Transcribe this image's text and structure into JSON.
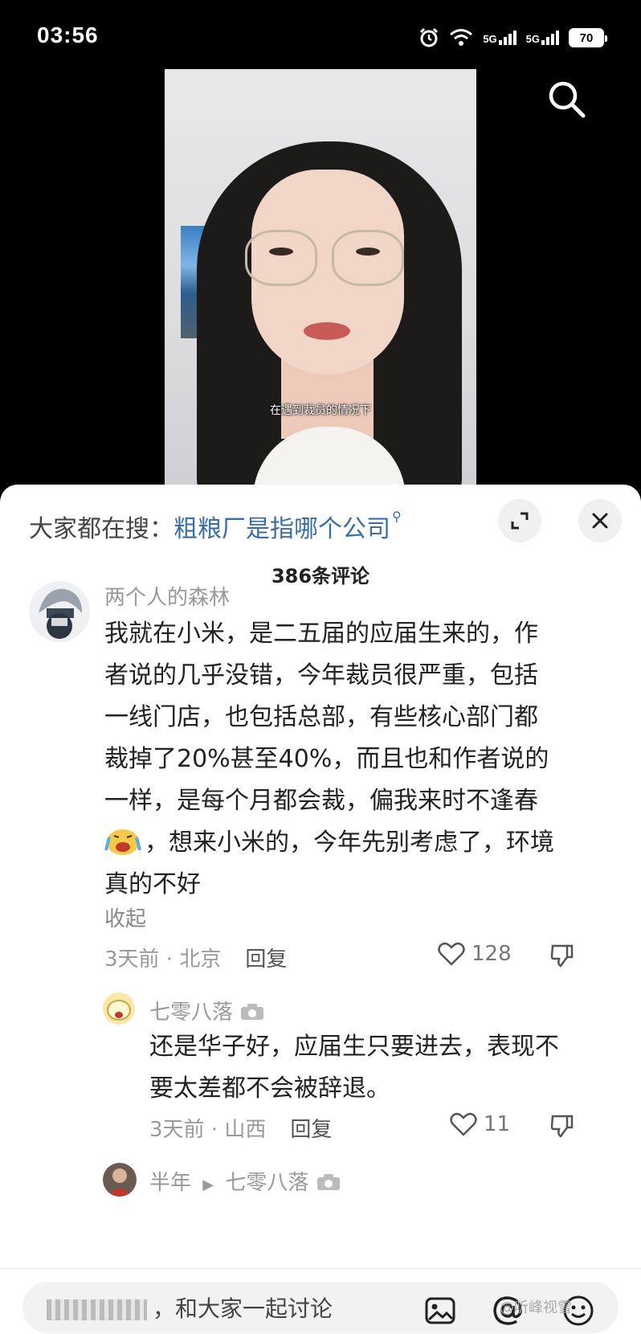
{
  "status_bar": {
    "time": "03:56",
    "network1": "5G",
    "network2": "5G",
    "battery": "70"
  },
  "video": {
    "subtitle": "在遇到裁员的情况下"
  },
  "search_trend": {
    "prefix": "大家都在搜：",
    "query": "粗粮厂是指哪个公司"
  },
  "comments_count": "386条评论",
  "comments": [
    {
      "username": "两个人的森林",
      "lines": [
        "我就在小米，是二五届的应届生来的，作",
        "者说的几乎没错，今年裁员很严重，包括",
        "一线门店，也包括总部，有些核心部门都",
        "裁掉了20%甚至40%，而且也和作者说的",
        "一样，是每个月都会裁，偏我来时不逢春",
        "，想来小米的，今年先别考虑了，环境",
        "真的不好"
      ],
      "collapse": "收起",
      "time_location": "3天前 · 北京",
      "reply": "回复",
      "likes": "128"
    },
    {
      "username": "七零八落",
      "lines": [
        "还是华子好，应届生只要进去，表现不",
        "要太差都不会被辞退。"
      ],
      "time_location": "3天前 · 山西",
      "reply": "回复",
      "likes": "11"
    },
    {
      "username": "半年",
      "reply_to": "七零八落"
    }
  ],
  "input": {
    "placeholder": "，和大家一起讨论"
  },
  "watermark": "@听峰视雪",
  "colors": {
    "link": "#3a6ea5",
    "muted": "#999999",
    "text": "#222222"
  }
}
